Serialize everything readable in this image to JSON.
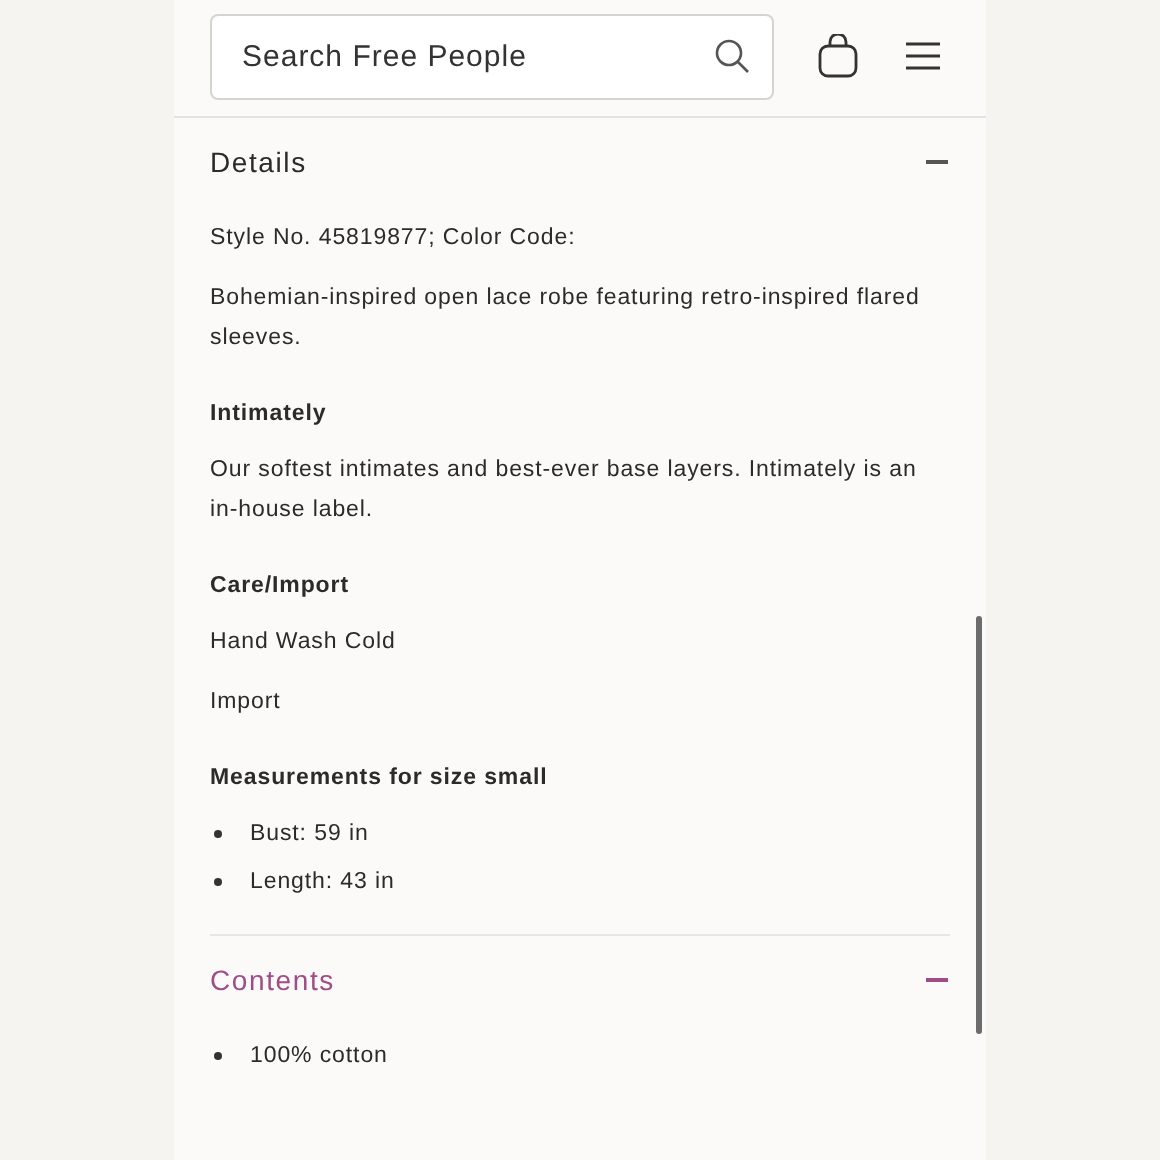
{
  "search": {
    "placeholder": "Search Free People"
  },
  "sections": [
    {
      "title": "Details",
      "expanded": true,
      "highlighted": false,
      "blocks": [
        {
          "kind": "text",
          "text": "Style No. 45819877; Color Code:"
        },
        {
          "kind": "text",
          "text": "Bohemian-inspired open lace robe featuring retro-inspired flared sleeves."
        },
        {
          "kind": "heading",
          "text": "Intimately"
        },
        {
          "kind": "text",
          "text": "Our softest intimates and best-ever base layers. Intimately is an in-house label."
        },
        {
          "kind": "heading",
          "text": "Care/Import"
        },
        {
          "kind": "text",
          "text": "Hand Wash Cold"
        },
        {
          "kind": "text",
          "text": "Import"
        },
        {
          "kind": "heading",
          "text": "Measurements for size small"
        },
        {
          "kind": "bullets",
          "items": [
            "Bust: 59 in",
            "Length: 43 in"
          ]
        }
      ]
    },
    {
      "title": "Contents",
      "expanded": true,
      "highlighted": true,
      "blocks": [
        {
          "kind": "bullets",
          "items": [
            "100% cotton"
          ]
        }
      ]
    }
  ]
}
